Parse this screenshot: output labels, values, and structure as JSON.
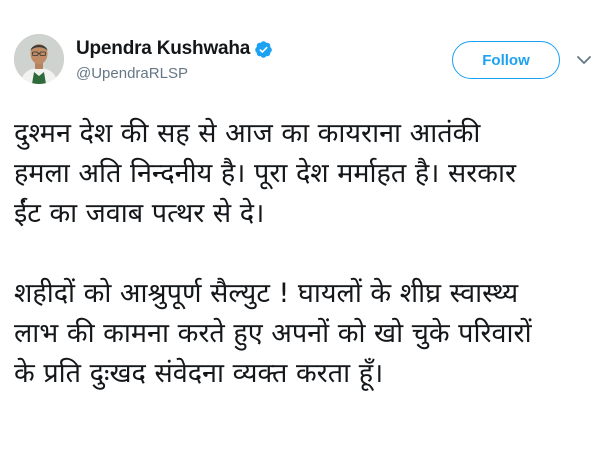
{
  "tweet": {
    "author": {
      "display_name": "Upendra Kushwaha",
      "handle": "@UpendraRLSP",
      "verified": true
    },
    "follow_label": "Follow",
    "paragraphs": [
      "दुश्मन देश की सह से आज का कायराना आतंकी\nहमला अति निन्दनीय है। पूरा देश मर्माहत है। सरकार\nईंट का जवाब पत्थर से दे।",
      "शहीदों को आश्रुपूर्ण सैल्युट ! घायलों के शीघ्र स्वास्थ्य\nलाभ की कामना करते हुए अपनों को खो चुके परिवारों\nके प्रति दुःखद संवेदना व्यक्त करता हूँ।"
    ]
  },
  "icons": {
    "verified": "verified-badge-icon",
    "caret": "chevron-down-icon"
  },
  "colors": {
    "accent": "#1da1f2",
    "text_primary": "#14171a",
    "text_secondary": "#657786"
  }
}
